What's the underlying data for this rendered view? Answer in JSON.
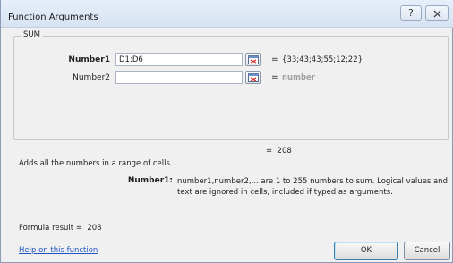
{
  "dialog": {
    "title": "Function Arguments",
    "help_glyph": "?",
    "function_name": "SUM",
    "args": [
      {
        "label": "Number1",
        "value": "D1:D6",
        "result": "{33;43;43;55;12;22}"
      },
      {
        "label": "Number2",
        "value": "",
        "result": "number"
      }
    ],
    "equals": "=",
    "total_result": "208",
    "description": "Adds all the numbers in a range of cells.",
    "arg_help": {
      "name": "Number1:",
      "text": "number1,number2,... are 1 to 255 numbers to sum. Logical values and text are ignored in cells, included if typed as arguments."
    },
    "formula_result_label": "Formula result =",
    "formula_result_value": "208",
    "help_link": "Help on this function",
    "ok_label": "OK",
    "cancel_label": "Cancel"
  },
  "icons": {
    "help": "question-mark-icon",
    "close": "close-icon",
    "range_select": "collapse-dialog-icon"
  },
  "colors": {
    "link": "#1f55c4",
    "placeholder_result": "#a0a0a0"
  }
}
